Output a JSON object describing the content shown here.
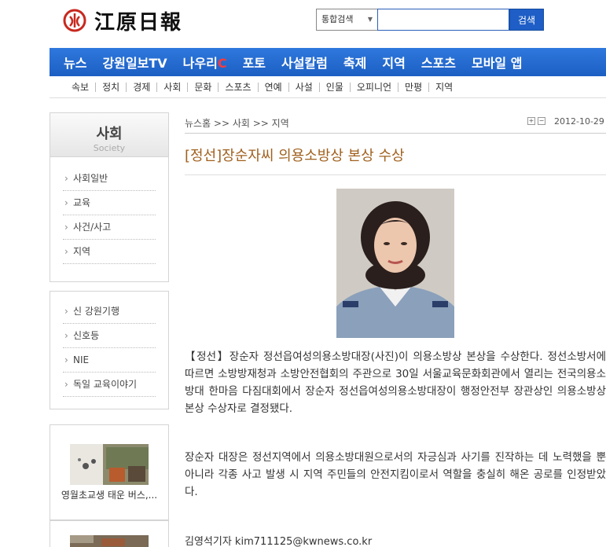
{
  "logo": {
    "text": "江原日報"
  },
  "search": {
    "select_label": "통합검색",
    "button_label": "검색"
  },
  "mainnav": [
    {
      "label": "뉴스"
    },
    {
      "label": "강원일보TV"
    },
    {
      "label": "나우리",
      "accent": "C"
    },
    {
      "label": "포토"
    },
    {
      "label": "사설칼럼"
    },
    {
      "label": "축제"
    },
    {
      "label": "지역"
    },
    {
      "label": "스포츠"
    },
    {
      "label": "모바일 앱"
    }
  ],
  "subnav": [
    "속보",
    "정치",
    "경제",
    "사회",
    "문화",
    "스포츠",
    "연예",
    "사설",
    "인물",
    "오피니언",
    "만평",
    "지역"
  ],
  "sidebar": {
    "title": "사회",
    "subtitle": "Society",
    "items": [
      "사회일반",
      "교육",
      "사건/사고",
      "지역"
    ],
    "items2": [
      "신 강원기행",
      "신호등",
      "NIE",
      "독일 교육이야기"
    ],
    "thumb_caption": "영월초교생 태운 버스,..."
  },
  "article": {
    "breadcrumb": "뉴스홈 >> 사회 >> 지역",
    "date": "2012-10-29",
    "headline": "[정선]장순자씨 의용소방상 본상 수상",
    "para1": "【정선】장순자 정선읍여성의용소방대장(사진)이 의용소방상 본상을 수상한다. 정선소방서에 따르면 소방방재청과 소방안전협회의 주관으로 30일 서울교육문화회관에서 열리는 전국의용소방대 한마음 다짐대회에서 장순자 정선읍여성의용소방대장이 행정안전부 장관상인 의용소방상 본상 수상자로 결정됐다.",
    "para2": "장순자 대장은 정선지역에서 의용소방대원으로서의 자긍심과 사기를 진작하는 데 노력했을 뿐 아니라 각종 사고 발생 시 지역 주민들의 안전지킴이로서 역할을 충실히 해온 공로를 인정받았다.",
    "byline": "김영석기자 kim711125@kwnews.co.kr"
  },
  "colors": {
    "nav": "#1e5ec6",
    "headline": "#a0601e",
    "logo_red": "#c8281e"
  }
}
